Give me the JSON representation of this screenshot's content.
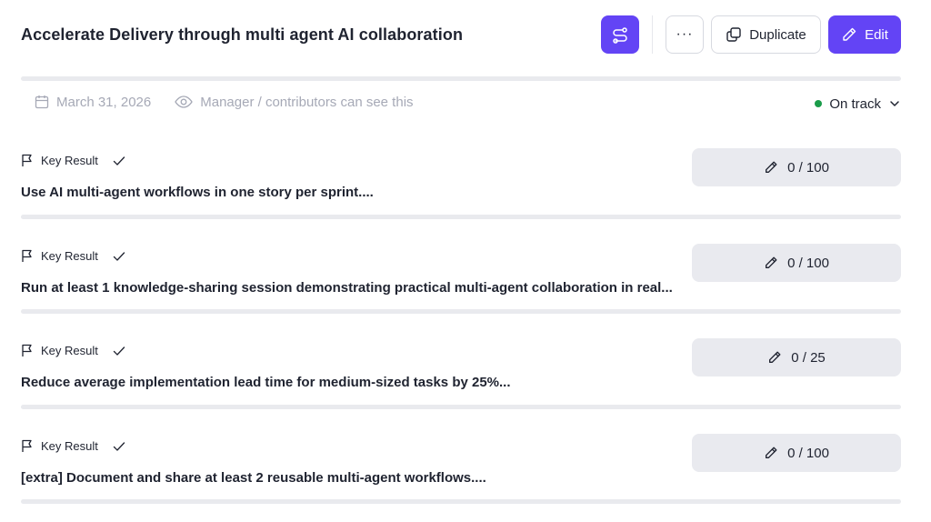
{
  "objective": {
    "title": "Accelerate Delivery through multi agent AI collaboration",
    "progress_percent": 0
  },
  "toolbar": {
    "more_label": "···",
    "duplicate_label": "Duplicate",
    "edit_label": "Edit"
  },
  "meta": {
    "due_date": "March 31, 2026",
    "visibility": "Manager / contributors can see this",
    "status": "On track",
    "status_color": "#1a9c4a"
  },
  "colors": {
    "accent": "#6344f5",
    "track": "#e9eaee"
  },
  "key_results": [
    {
      "label": "Key Result",
      "text": "Use AI multi-agent workflows in one story per sprint....",
      "progress": "0 / 100",
      "current": 0,
      "target": 100
    },
    {
      "label": "Key Result",
      "text": "Run at least 1 knowledge-sharing session demonstrating practical multi-agent collaboration in real...",
      "progress": "0 / 100",
      "current": 0,
      "target": 100
    },
    {
      "label": "Key Result",
      "text": "Reduce average implementation lead time for medium-sized tasks by 25%...",
      "progress": "0 / 25",
      "current": 0,
      "target": 25
    },
    {
      "label": "Key Result",
      "text": "[extra] Document and share at least 2 reusable multi-agent workflows....",
      "progress": "0 / 100",
      "current": 0,
      "target": 100
    }
  ]
}
